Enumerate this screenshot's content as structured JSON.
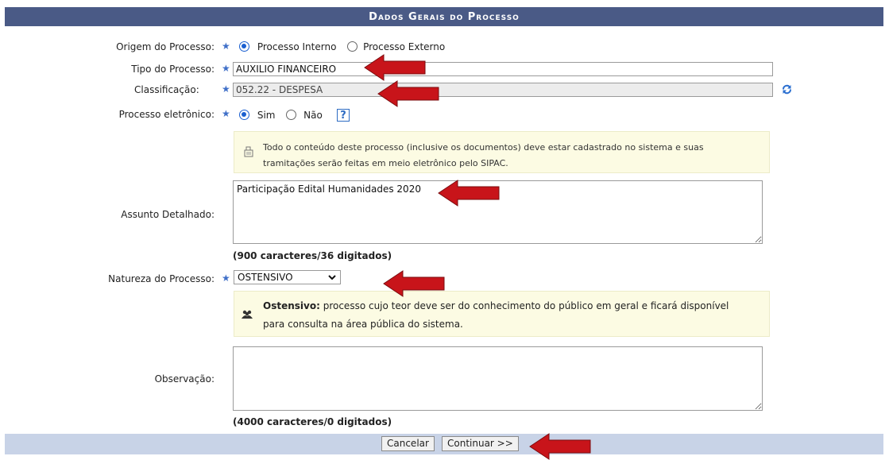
{
  "header": {
    "title": "Dados Gerais do Processo"
  },
  "origem": {
    "label": "Origem do Processo:",
    "opt1": "Processo Interno",
    "opt2": "Processo Externo",
    "selected": "Processo Interno"
  },
  "tipo": {
    "label": "Tipo do Processo:",
    "value": "AUXILIO FINANCEIRO"
  },
  "classificacao": {
    "label": "Classificação:",
    "value": "052.22 - DESPESA"
  },
  "eletronico": {
    "label": "Processo eletrônico:",
    "opt1": "Sim",
    "opt2": "Não",
    "selected": "Sim",
    "help": "?"
  },
  "eletronico_note": {
    "line1": "Todo o conteúdo deste processo (inclusive os documentos) deve estar cadastrado no sistema e suas",
    "line2": "tramitações serão feitas em meio eletrônico pelo SIPAC."
  },
  "assunto": {
    "label": "Assunto Detalhado:",
    "value": "Participação Edital Humanidades 2020",
    "counter": "(900 caracteres/36 digitados)"
  },
  "natureza": {
    "label": "Natureza do Processo:",
    "value": "OSTENSIVO"
  },
  "natureza_note": {
    "bold": "Ostensivo:",
    "line1": " processo cujo teor deve ser do conhecimento do público em geral e ficará disponível",
    "line2": "para consulta na área pública do sistema."
  },
  "observacao": {
    "label": "Observação:",
    "value": "",
    "counter": "(4000 caracteres/0 digitados)"
  },
  "buttons": {
    "cancel": "Cancelar",
    "continue": "Continuar >>"
  },
  "colors": {
    "header_bg": "#4a5a86",
    "footer_bg": "#c8d3e7",
    "note_bg": "#fcfbe3",
    "arrow": "#c8141a",
    "required_star": "#3f6fc8"
  },
  "icons": {
    "refresh": "refresh-icon",
    "help": "help-icon",
    "doc": "document-icon",
    "users": "users-icon"
  }
}
